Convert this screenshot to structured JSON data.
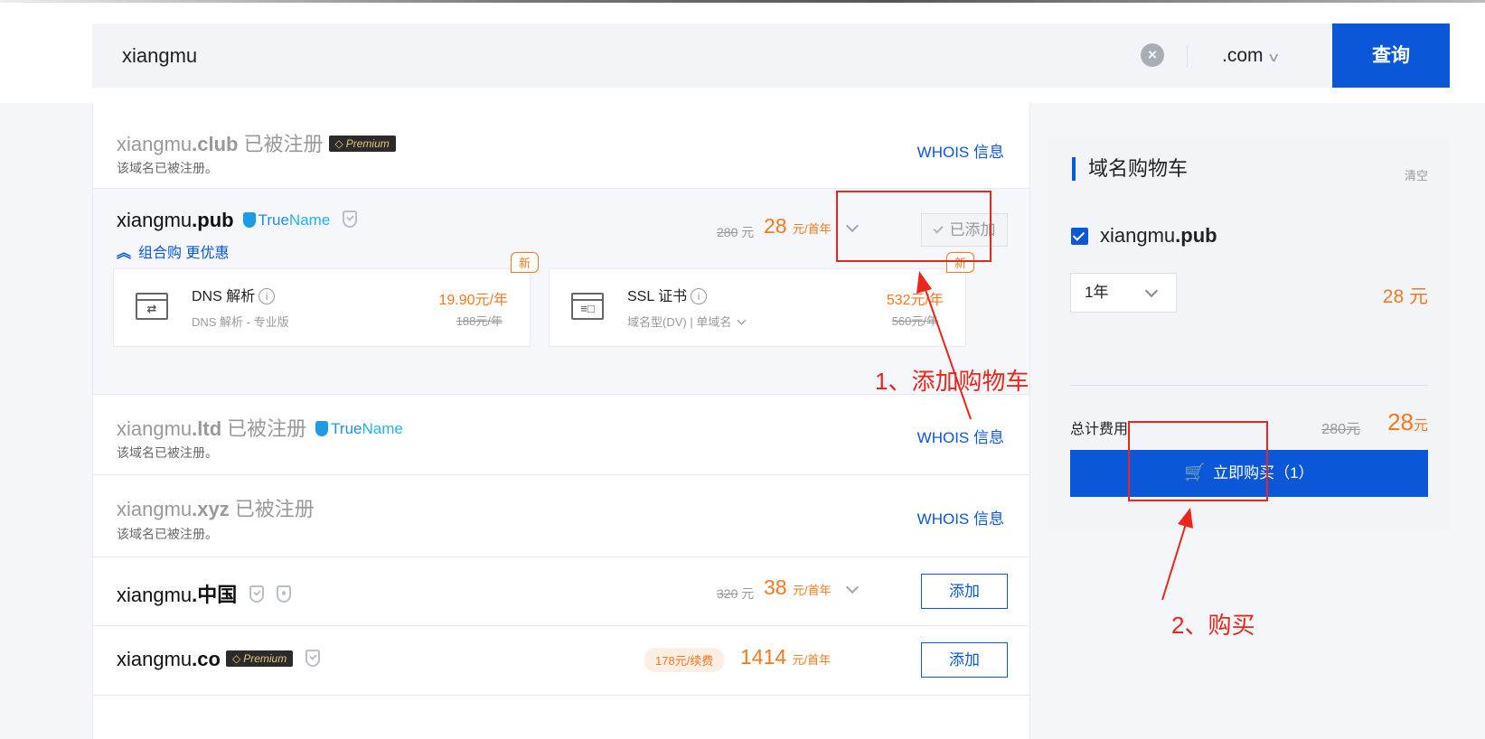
{
  "search": {
    "query": "xiangmu",
    "suffix": ".com",
    "button_label": "查询"
  },
  "results": [
    {
      "name": "xiangmu",
      "tld": ".club",
      "status": "已被注册",
      "badge": "Premium",
      "sub": "该域名已被注册。",
      "action": "WHOIS 信息"
    },
    {
      "name": "xiangmu",
      "tld": ".pub",
      "badge": "TrueName",
      "orig_price": "280",
      "orig_unit": "元",
      "price": "28",
      "unit": "元/首年",
      "action": "已添加",
      "combo": "组合购 更优惠"
    },
    {
      "name": "xiangmu",
      "tld": ".ltd",
      "status": "已被注册",
      "badge": "TrueName",
      "sub": "该域名已被注册。",
      "action": "WHOIS 信息"
    },
    {
      "name": "xiangmu",
      "tld": ".xyz",
      "status": "已被注册",
      "sub": "该域名已被注册。",
      "action": "WHOIS 信息"
    },
    {
      "name": "xiangmu",
      "tld": ".中国",
      "orig_price": "320",
      "orig_unit": "元",
      "price": "38",
      "unit": "元/首年",
      "action": "添加"
    },
    {
      "name": "xiangmu",
      "tld": ".co",
      "badge": "Premium",
      "renew": "178元/续费",
      "price": "1414",
      "unit": "元/首年",
      "action": "添加"
    }
  ],
  "trustname": {
    "a": "True",
    "b": "Name"
  },
  "services": [
    {
      "tag": "新",
      "title": "DNS 解析",
      "info": "i",
      "sub": "DNS 解析 - 专业版",
      "price": "19.90元/年",
      "orig": "188元/年",
      "glyph": "⇄"
    },
    {
      "tag": "新",
      "title": "SSL 证书",
      "info": "i",
      "sub": "域名型(DV) | 单域名",
      "price": "532元/年",
      "orig": "560元/年",
      "glyph": "≡□"
    }
  ],
  "cart": {
    "title": "域名购物车",
    "clear": "清空",
    "item_name": "xiangmu",
    "item_tld": ".pub",
    "period": "1年",
    "item_price": "28 元",
    "total_label": "总计费用",
    "total_orig": "280元",
    "total_now": "28",
    "total_unit": "元",
    "buy_label": "立即购买（1）"
  },
  "annotations": {
    "step1": "1、添加购物车",
    "step2": "2、购买"
  },
  "colors": {
    "primary": "#0a57d7",
    "price": "#f5781e",
    "annotation": "#e8261b"
  }
}
